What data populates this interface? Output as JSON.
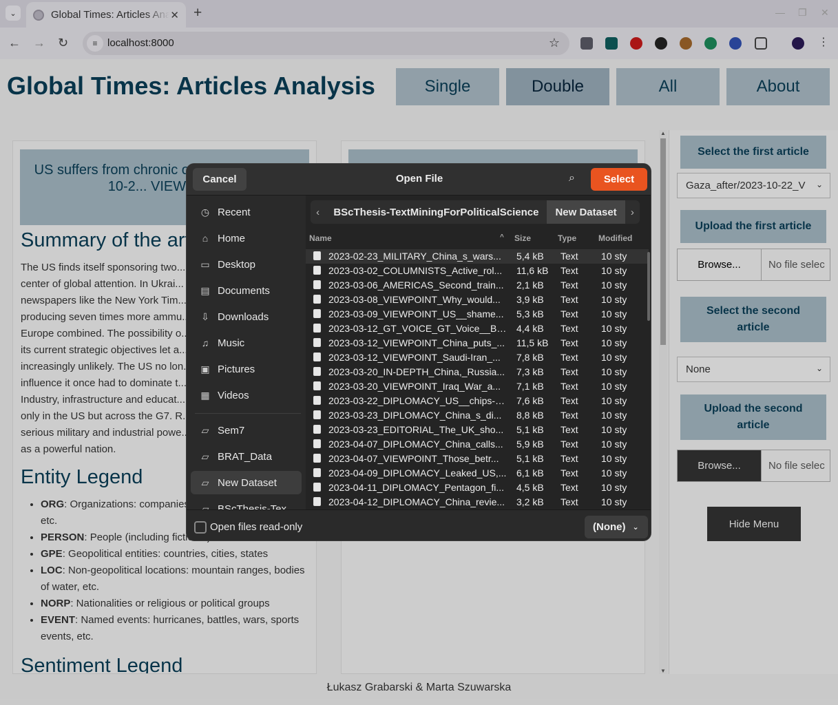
{
  "browser": {
    "tab_title": "Global Times: Articles Analysis",
    "url": "localhost:8000"
  },
  "page": {
    "site_title": "Global Times: Articles Analysis",
    "nav": [
      "Single",
      "Double",
      "All",
      "About"
    ],
    "active_nav": "Double",
    "article_title": "US suffers from chronic overreach -- 2023-10-2... VIEWPOI...",
    "summary_heading": "Summary of the arti...",
    "summary_lines": [
      "The US finds itself sponsoring two...",
      "center of global attention. In Ukrai...",
      "newspapers like the New York Tim...",
      "producing seven times more ammu...",
      "Europe combined. The possibility o...",
      "its current strategic objectives let a...",
      "increasingly unlikely. The US no lon...",
      "influence it once had to dominate t...",
      "Industry, infrastructure and educat...",
      "only in the US but across the G7. R...",
      "serious military and industrial powe...",
      "as a powerful nation."
    ],
    "entity_heading": "Entity Legend",
    "entities": [
      {
        "tag": "ORG",
        "desc": ": Organizations: companies, agencies, institutions, etc."
      },
      {
        "tag": "PERSON",
        "desc": ": People (including fictional)"
      },
      {
        "tag": "GPE",
        "desc": ": Geopolitical entities: countries, cities, states"
      },
      {
        "tag": "LOC",
        "desc": ": Non-geopolitical locations: mountain ranges, bodies of water, etc."
      },
      {
        "tag": "NORP",
        "desc": ": Nationalities or religious or political groups"
      },
      {
        "tag": "EVENT",
        "desc": ": Named events: hurricanes, battles, wars, sports events, etc."
      }
    ],
    "sentiment_heading": "Sentiment Legend",
    "footer": "Łukasz Grabarski & Marta Szuwarska"
  },
  "sidebar": {
    "select_first_label": "Select the first article",
    "first_select_value": "Gaza_after/2023-10-22_V",
    "upload_first_label": "Upload the first article",
    "browse_label": "Browse...",
    "no_file_label": "No file selec",
    "select_second_label": "Select the second article",
    "second_select_value": "None",
    "upload_second_label": "Upload the second article",
    "hide_menu_label": "Hide Menu"
  },
  "dialog": {
    "title": "Open File",
    "cancel_label": "Cancel",
    "select_label": "Select",
    "places": [
      "Recent",
      "Home",
      "Desktop",
      "Documents",
      "Downloads",
      "Music",
      "Pictures",
      "Videos"
    ],
    "bookmarks": [
      "Sem7",
      "BRAT_Data",
      "New Dataset",
      "BScThesis-Tex..."
    ],
    "active_place": "New Dataset",
    "path": [
      "BScThesis-TextMiningForPoliticalScience",
      "New Dataset"
    ],
    "columns": {
      "name": "Name",
      "size": "Size",
      "type": "Type",
      "modified": "Modified"
    },
    "files": [
      {
        "name": "2023-02-23_MILITARY_China_s_wars...",
        "size": "5,4 kB",
        "type": "Text",
        "modified": "10 sty"
      },
      {
        "name": "2023-03-02_COLUMNISTS_Active_rol...",
        "size": "11,6 kB",
        "type": "Text",
        "modified": "10 sty"
      },
      {
        "name": "2023-03-06_AMERICAS_Second_train...",
        "size": "2,1 kB",
        "type": "Text",
        "modified": "10 sty"
      },
      {
        "name": "2023-03-08_VIEWPOINT_Why_would...",
        "size": "3,9 kB",
        "type": "Text",
        "modified": "10 sty"
      },
      {
        "name": "2023-03-09_VIEWPOINT_US__shame...",
        "size": "5,3 kB",
        "type": "Text",
        "modified": "10 sty"
      },
      {
        "name": "2023-03-12_GT_VOICE_GT_Voice__Be...",
        "size": "4,4 kB",
        "type": "Text",
        "modified": "10 sty"
      },
      {
        "name": "2023-03-12_VIEWPOINT_China_puts_...",
        "size": "11,5 kB",
        "type": "Text",
        "modified": "10 sty"
      },
      {
        "name": "2023-03-12_VIEWPOINT_Saudi-Iran_...",
        "size": "7,8 kB",
        "type": "Text",
        "modified": "10 sty"
      },
      {
        "name": "2023-03-20_IN-DEPTH_China,_Russia...",
        "size": "7,3 kB",
        "type": "Text",
        "modified": "10 sty"
      },
      {
        "name": "2023-03-20_VIEWPOINT_Iraq_War_a...",
        "size": "7,1 kB",
        "type": "Text",
        "modified": "10 sty"
      },
      {
        "name": "2023-03-22_DIPLOMACY_US__chips-s...",
        "size": "7,6 kB",
        "type": "Text",
        "modified": "10 sty"
      },
      {
        "name": "2023-03-23_DIPLOMACY_China_s_di...",
        "size": "8,8 kB",
        "type": "Text",
        "modified": "10 sty"
      },
      {
        "name": "2023-03-23_EDITORIAL_The_UK_sho...",
        "size": "5,1 kB",
        "type": "Text",
        "modified": "10 sty"
      },
      {
        "name": "2023-04-07_DIPLOMACY_China_calls...",
        "size": "5,9 kB",
        "type": "Text",
        "modified": "10 sty"
      },
      {
        "name": "2023-04-07_VIEWPOINT_Those_betr...",
        "size": "5,1 kB",
        "type": "Text",
        "modified": "10 sty"
      },
      {
        "name": "2023-04-09_DIPLOMACY_Leaked_US,...",
        "size": "6,1 kB",
        "type": "Text",
        "modified": "10 sty"
      },
      {
        "name": "2023-04-11_DIPLOMACY_Pentagon_fi...",
        "size": "4,5 kB",
        "type": "Text",
        "modified": "10 sty"
      },
      {
        "name": "2023-04-12_DIPLOMACY_China_revie...",
        "size": "3,2 kB",
        "type": "Text",
        "modified": "10 sty"
      }
    ],
    "readonly_label": "Open files read-only",
    "filter_label": "(None)"
  }
}
